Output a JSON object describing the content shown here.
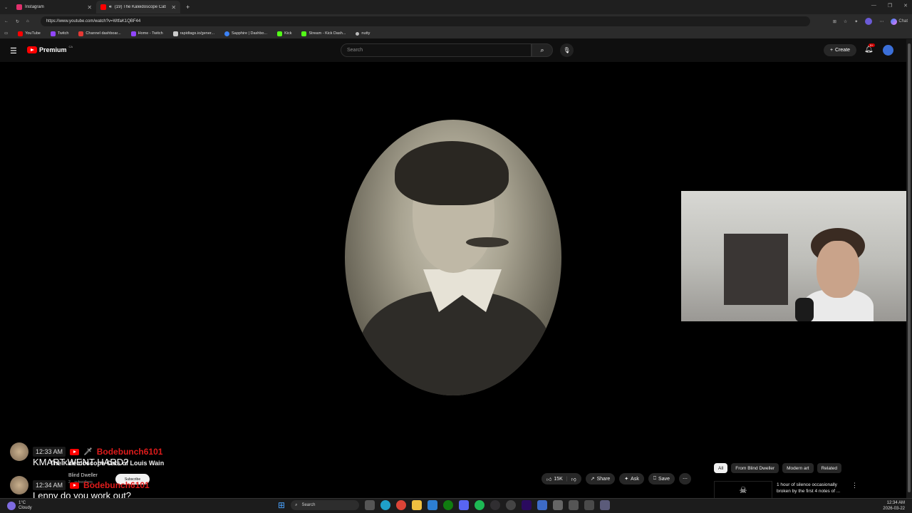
{
  "browser": {
    "tabs": [
      {
        "label": "Instagram",
        "color": "#e1306c"
      },
      {
        "label": "(19) The Kaleidoscope Cats of",
        "color": "#ff0000"
      }
    ],
    "url": "https://www.youtube.com/watch?v=WtfaK1QBF44",
    "chat_label": "Chat",
    "bookmarks": [
      {
        "label": "YouTube",
        "color": "#ff0000"
      },
      {
        "label": "Twitch",
        "color": "#9146ff"
      },
      {
        "label": "Channel dashboar...",
        "color": "#e53935"
      },
      {
        "label": "Home - Twitch",
        "color": "#9146ff"
      },
      {
        "label": "rapidtags.io/gener...",
        "color": "#cccccc"
      },
      {
        "label": "Sapphire | Dashbo...",
        "color": "#3b82f6"
      },
      {
        "label": "Kick",
        "color": "#53fc18"
      },
      {
        "label": "Stream - Kick Dash...",
        "color": "#53fc18"
      },
      {
        "label": "nutty",
        "color": "#bbbbbb"
      }
    ]
  },
  "youtube": {
    "logo_text": "Premium",
    "region": "CA",
    "search_placeholder": "Search",
    "create_label": "Create",
    "notif_badge": "9+",
    "video_title": "The Kaleidoscope Cats of Louis Wain",
    "channel": "Blind Dweller",
    "subscribers": "2... subscribers",
    "subscribe_label": "Subscribe",
    "likes": "15K",
    "share_label": "Share",
    "ask_label": "Ask",
    "save_label": "Save",
    "chips": [
      "All",
      "From Blind Dweller",
      "Modern art",
      "Related"
    ],
    "recommendation_title": "1 hour of silence occasionally broken by the first 4 notes of ..."
  },
  "chat": [
    {
      "time": "12:33 AM",
      "user": "Bodebunch6101",
      "message": "KMART WENT HARD?"
    },
    {
      "time": "12:34 AM",
      "user": "Bodebunch6101",
      "message": "Lenny do you work out?"
    }
  ],
  "taskbar": {
    "temp": "1°C",
    "weather": "Cloudy",
    "search_label": "Search",
    "time": "12:34 AM",
    "date": "2026-03-22"
  }
}
